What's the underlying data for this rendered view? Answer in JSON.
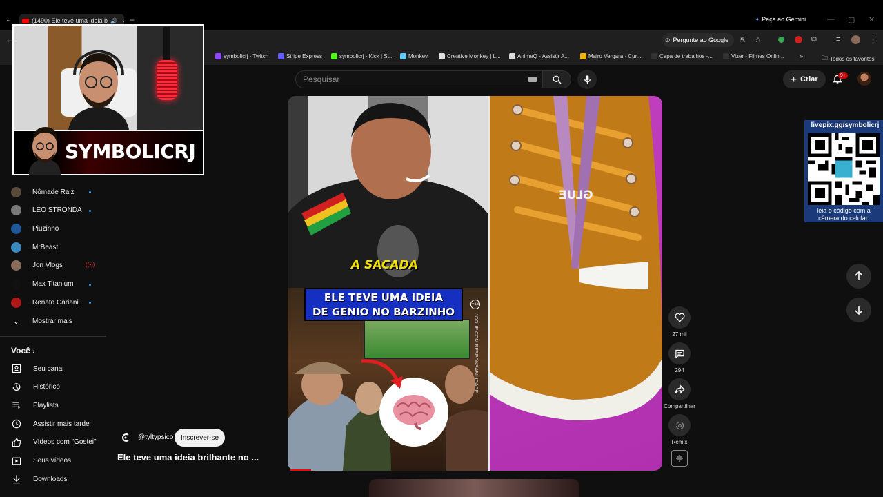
{
  "browser": {
    "tab_title": "(1490) Ele teve uma ideia b",
    "new_tab": "+",
    "gemini": "Peça ao Gemini",
    "pergunte": "Pergunte ao Google",
    "bookmarks": [
      {
        "label": "symbolicrj - Twitch",
        "color": "#9146ff"
      },
      {
        "label": "Stripe Express",
        "color": "#635bff"
      },
      {
        "label": "symbolicrj - Kick | St...",
        "color": "#53fc18"
      },
      {
        "label": "Monkey",
        "color": "#66ccff"
      },
      {
        "label": "Creative Monkey | L...",
        "color": "#dddddd"
      },
      {
        "label": "AnimeQ - Assistir A...",
        "color": "#dddddd"
      },
      {
        "label": "Mairo Vergara - Cur...",
        "color": "#f2b600"
      },
      {
        "label": "Capa de trabalhos -...",
        "color": "#333333"
      },
      {
        "label": "Vizer - Filmes Onlin...",
        "color": "#333333"
      }
    ],
    "all_bookmarks": "Todos os favoritos"
  },
  "header": {
    "search_placeholder": "Pesquisar",
    "create_label": "Criar",
    "notif_badge": "9+"
  },
  "overlay": {
    "streamer_name": "SYMBOLICRJ"
  },
  "sidebar": {
    "subscriptions": [
      {
        "name": "Nômade Raiz",
        "color": "#5a4a3a",
        "status": "dot"
      },
      {
        "name": "LEO STRONDA",
        "color": "#7a7a7a",
        "status": "dot"
      },
      {
        "name": "Piuzinho",
        "color": "#1e5a9a",
        "status": "none"
      },
      {
        "name": "MrBeast",
        "color": "#3a8ac0",
        "status": "none"
      },
      {
        "name": "Jon Vlogs",
        "color": "#8a6a5a",
        "status": "live"
      },
      {
        "name": "Max Titanium",
        "color": "#111111",
        "status": "dot"
      },
      {
        "name": "Renato Cariani",
        "color": "#b01818",
        "status": "dot"
      }
    ],
    "show_more": "Mostrar mais",
    "you_heading": "Você",
    "you_items": [
      {
        "label": "Seu canal",
        "icon": "channel-icon"
      },
      {
        "label": "Histórico",
        "icon": "history-icon"
      },
      {
        "label": "Playlists",
        "icon": "playlists-icon"
      },
      {
        "label": "Assistir mais tarde",
        "icon": "watch-later-icon"
      },
      {
        "label": "Vídeos com \"Gostei\"",
        "icon": "liked-icon"
      },
      {
        "label": "Seus vídeos",
        "icon": "your-videos-icon"
      },
      {
        "label": "Downloads",
        "icon": "downloads-icon"
      }
    ]
  },
  "short": {
    "headline_line1": "ELE TEVE UMA IDEIA",
    "headline_line2": "DE GENIO NO BARZINHO",
    "sacada": "A SACADA",
    "glue_text": "GLUE",
    "age_tag": "+18",
    "side_text": "JOGUE COM RESPONSABILIDADE",
    "channel_handle": "@tyltypsico",
    "subscribe_label": "Inscrever-se",
    "title": "Ele teve uma ideia brilhante no ...",
    "likes": "27 mil",
    "comments": "294",
    "share_label": "Compartilhar",
    "remix_label": "Remix"
  },
  "qr": {
    "top": "livepix.gg/symbolicrj",
    "bottom_line1": "leia o código com a",
    "bottom_line2": "câmera do celular."
  }
}
